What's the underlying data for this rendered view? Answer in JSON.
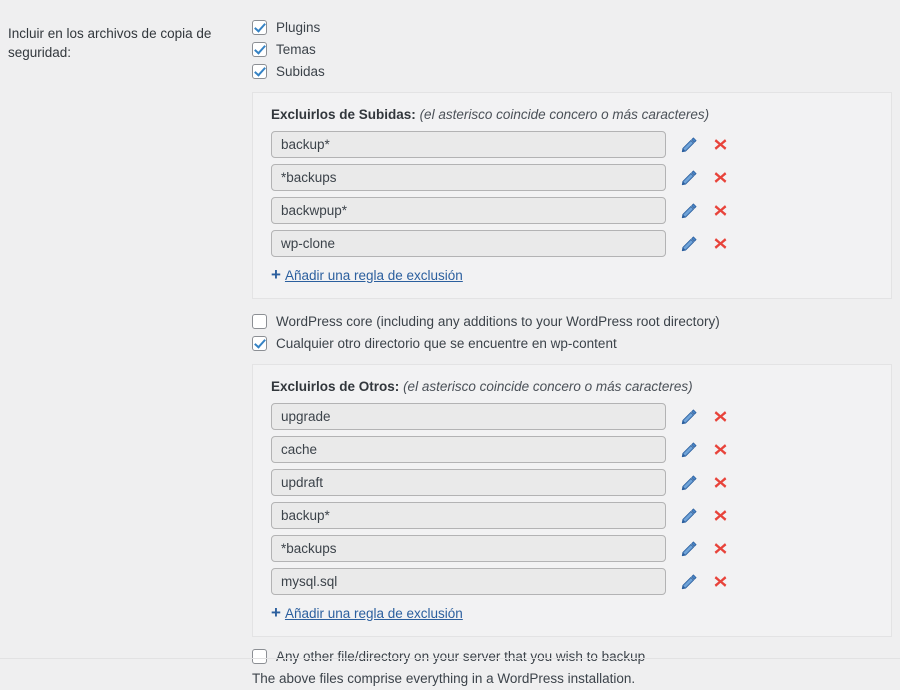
{
  "form": {
    "label": "Incluir en los archivos de copia de seguridad:",
    "colors": {
      "accent_blue": "#3582c4",
      "link_blue": "#2b5f9e",
      "delete_red": "#e8433a",
      "page_background": "#efeff0",
      "panel_background": "#f2f2f3",
      "input_background": "#eaeaea"
    },
    "top_checkboxes": [
      {
        "label": "Plugins",
        "checked": true
      },
      {
        "label": "Temas",
        "checked": true
      },
      {
        "label": "Subidas",
        "checked": true
      }
    ],
    "uploads_panel": {
      "title": "Excluirlos de Subidas:",
      "hint": "(el asterisco coincide concero o más caracteres)",
      "rules": [
        {
          "value": "backup*"
        },
        {
          "value": "*backups"
        },
        {
          "value": "backwpup*"
        },
        {
          "value": "wp-clone"
        }
      ],
      "add_label": "Añadir una regla de exclusión",
      "plus": "+",
      "edit_icon": "pencil-icon",
      "delete_icon": "x-icon"
    },
    "mid_checkboxes": [
      {
        "label": "WordPress core (including any additions to your WordPress root directory)",
        "checked": false
      },
      {
        "label": "Cualquier otro directorio que se encuentre en wp-content",
        "checked": true
      }
    ],
    "others_panel": {
      "title": "Excluirlos de Otros:",
      "hint": "(el asterisco coincide concero o más caracteres)",
      "rules": [
        {
          "value": "upgrade"
        },
        {
          "value": "cache"
        },
        {
          "value": "updraft"
        },
        {
          "value": "backup*"
        },
        {
          "value": "*backups"
        },
        {
          "value": "mysql.sql"
        }
      ],
      "add_label": "Añadir una regla de exclusión",
      "plus": "+",
      "edit_icon": "pencil-icon",
      "delete_icon": "x-icon"
    },
    "bottom_checkbox": {
      "label": "Any other file/directory on your server that you wish to backup",
      "checked": false
    },
    "footer_note": "The above files comprise everything in a WordPress installation."
  }
}
